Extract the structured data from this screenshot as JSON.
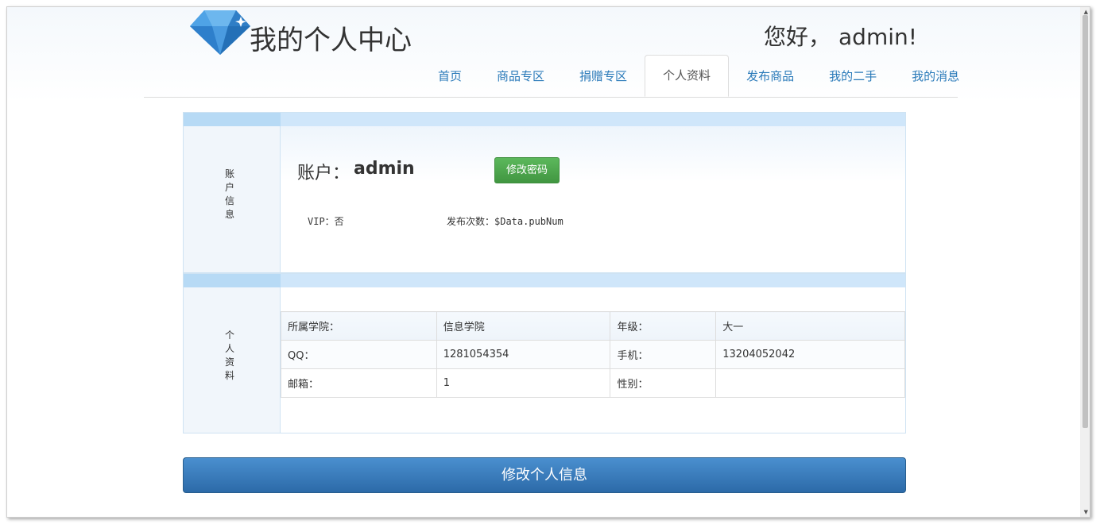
{
  "header": {
    "site_title": "我的个人中心",
    "greeting_prefix": "您好，",
    "username": "admin!"
  },
  "nav": {
    "items": [
      {
        "label": "首页"
      },
      {
        "label": "商品专区"
      },
      {
        "label": "捐赠专区"
      },
      {
        "label": "个人资料"
      },
      {
        "label": "发布商品"
      },
      {
        "label": "我的二手"
      },
      {
        "label": "我的消息"
      }
    ],
    "active": "个人资料"
  },
  "account": {
    "side_label": [
      "账",
      "户",
      "信",
      "息"
    ],
    "label": "账户：",
    "value": "admin",
    "change_password_label": "修改密码",
    "vip_text": "VIP：否",
    "pubnum_text": "发布次数：$Data.pubNum"
  },
  "profile": {
    "side_label": [
      "个",
      "人",
      "资",
      "料"
    ],
    "rows": [
      [
        "所属学院：",
        "信息学院",
        "年级：",
        "大一"
      ],
      [
        "QQ：",
        "1281054354",
        "手机：",
        "13204052042"
      ],
      [
        "邮箱：",
        "1",
        "性别：",
        ""
      ]
    ]
  },
  "actions": {
    "edit_profile_label": "修改个人信息"
  },
  "colors": {
    "link": "#2a7ab9",
    "success": "#5cb85c",
    "primary": "#2c6aa8",
    "panel_strip": "#cfe6fa"
  }
}
